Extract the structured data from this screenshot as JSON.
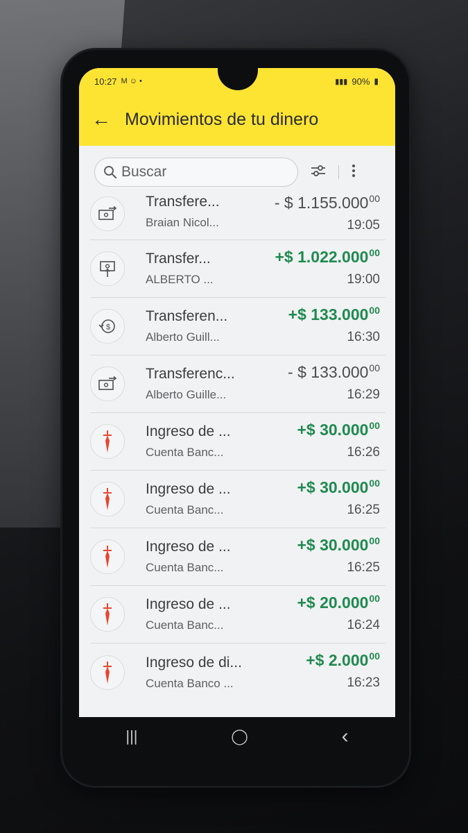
{
  "status_bar": {
    "time": "10:27",
    "notif_icons": "M ☺ •",
    "battery": "90%"
  },
  "header": {
    "title": "Movimientos de tu dinero",
    "back_icon": "arrow-left-icon"
  },
  "search": {
    "placeholder": "Buscar"
  },
  "colors": {
    "accent_yellow": "#fde433",
    "positive_green": "#1f8a50",
    "santander_red": "#e8452f"
  },
  "transactions": [
    {
      "title": "Transfere...",
      "subtitle": "Braian Nicol...",
      "amount": "- $ 1.155.000",
      "cents": "00",
      "time": "19:05",
      "icon": "transfer-out-icon",
      "sign": "neg"
    },
    {
      "title": "Transfer...",
      "subtitle": "ALBERTO ...",
      "amount": "+$ 1.022.000",
      "cents": "00",
      "time": "19:00",
      "icon": "transfer-in-icon",
      "sign": "pos"
    },
    {
      "title": "Transferen...",
      "subtitle": "Alberto Guill...",
      "amount": "+$ 133.000",
      "cents": "00",
      "time": "16:30",
      "icon": "money-return-icon",
      "sign": "pos"
    },
    {
      "title": "Transferenc...",
      "subtitle": "Alberto Guille...",
      "amount": "- $ 133.000",
      "cents": "00",
      "time": "16:29",
      "icon": "transfer-out-icon",
      "sign": "neg"
    },
    {
      "title": "Ingreso de ...",
      "subtitle": "Cuenta Banc...",
      "amount": "+$ 30.000",
      "cents": "00",
      "time": "16:26",
      "icon": "santander-flame-icon",
      "sign": "pos"
    },
    {
      "title": "Ingreso de ...",
      "subtitle": "Cuenta Banc...",
      "amount": "+$ 30.000",
      "cents": "00",
      "time": "16:25",
      "icon": "santander-flame-icon",
      "sign": "pos"
    },
    {
      "title": "Ingreso de ...",
      "subtitle": "Cuenta Banc...",
      "amount": "+$ 30.000",
      "cents": "00",
      "time": "16:25",
      "icon": "santander-flame-icon",
      "sign": "pos"
    },
    {
      "title": "Ingreso de ...",
      "subtitle": "Cuenta Banc...",
      "amount": "+$ 20.000",
      "cents": "00",
      "time": "16:24",
      "icon": "santander-flame-icon",
      "sign": "pos"
    },
    {
      "title": "Ingreso de di...",
      "subtitle": "Cuenta Banco ...",
      "amount": "+$ 2.000",
      "cents": "00",
      "time": "16:23",
      "icon": "santander-flame-icon",
      "sign": "pos"
    }
  ],
  "navbar": {
    "recents": "|||",
    "home": "◯",
    "back": "‹"
  }
}
